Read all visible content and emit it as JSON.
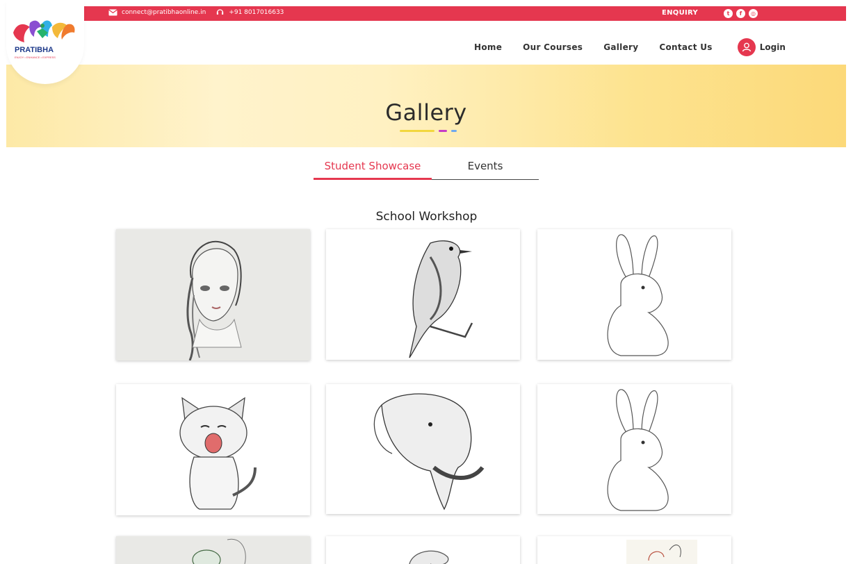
{
  "topbar": {
    "email": "connect@pratibhaonline.in",
    "phone": "+91 8017016633",
    "enquiry": "ENQUIRY",
    "social": [
      "twitter-icon",
      "facebook-icon",
      "instagram-icon"
    ]
  },
  "brand": {
    "name": "PRATIBHA",
    "tagline": "ENJOY • ENHANCE • EXPRESS",
    "colors": {
      "red": "#e5374f",
      "navy": "#1e3a8a",
      "yellow": "#f2d73e",
      "purple": "#c63cc7",
      "blue": "#6ea8ee"
    }
  },
  "nav": {
    "items": [
      "Home",
      "Our Courses",
      "Gallery",
      "Contact Us"
    ],
    "login": "Login"
  },
  "banner": {
    "title": "Gallery"
  },
  "tabs": [
    {
      "label": "Student Showcase",
      "active": true
    },
    {
      "label": "Events",
      "active": false
    }
  ],
  "section": {
    "title": "School Workshop"
  },
  "gallery": [
    {
      "subject": "girl-sketch"
    },
    {
      "subject": "bird-sketch"
    },
    {
      "subject": "rabbit-sketch"
    },
    {
      "subject": "kitten-sketch"
    },
    {
      "subject": "elephant-sketch"
    },
    {
      "subject": "rabbit-sketch"
    },
    {
      "subject": "sketch"
    },
    {
      "subject": "sketch"
    },
    {
      "subject": "sketch"
    }
  ]
}
